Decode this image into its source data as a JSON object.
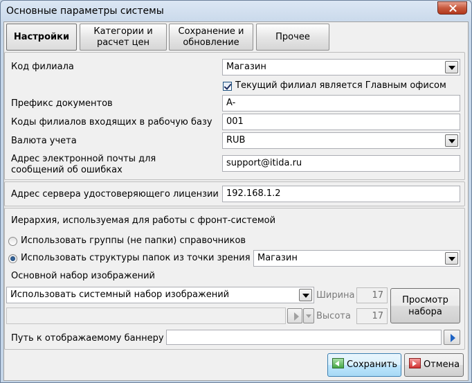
{
  "window": {
    "title": "Основные параметры системы"
  },
  "tabs": [
    {
      "label": "Настройки"
    },
    {
      "label": "Категории и расчет цен"
    },
    {
      "label": "Сохранение и обновление"
    },
    {
      "label": "Прочее"
    }
  ],
  "settings": {
    "branch_code_label": "Код филиала",
    "branch_code_value": "Магазин",
    "main_office_checkbox_label": "Текущий филиал является Главным офисом",
    "main_office_checked": true,
    "doc_prefix_label": "Префикс  документов",
    "doc_prefix_value": "A-",
    "incoming_codes_label": "Коды филиалов входящих в рабочую базу",
    "incoming_codes_value": "001",
    "currency_label": "Валюта учета",
    "currency_value": "RUB",
    "error_email_label_line1": "Адрес электронной почты для",
    "error_email_label_line2": "сообщений об ошибках",
    "error_email_value": "support@itida.ru"
  },
  "license": {
    "server_label": "Адрес сервера удостоверяющего лицензии",
    "server_value": "192.168.1.2"
  },
  "hierarchy": {
    "heading": "Иерархия, используемая для работы с фронт-системой",
    "option_groups_label": "Использовать группы (не папки)  справочников",
    "option_folders_label": "Использовать структуры папок из точки зрения",
    "selected_option": "folders",
    "viewpoint_value": "Магазин"
  },
  "images": {
    "heading": "Основной набор изображений",
    "set_value": "Использовать системный набор изображений",
    "width_label": "Ширина",
    "width_value": "17",
    "height_label": "Высота",
    "height_value": "17",
    "preview_button_line1": "Просмотр",
    "preview_button_line2": "набора"
  },
  "banner": {
    "path_label": "Путь к отображаемому баннеру",
    "path_value": ""
  },
  "footer": {
    "save_label": "Сохранить",
    "cancel_label": "Отмена"
  }
}
